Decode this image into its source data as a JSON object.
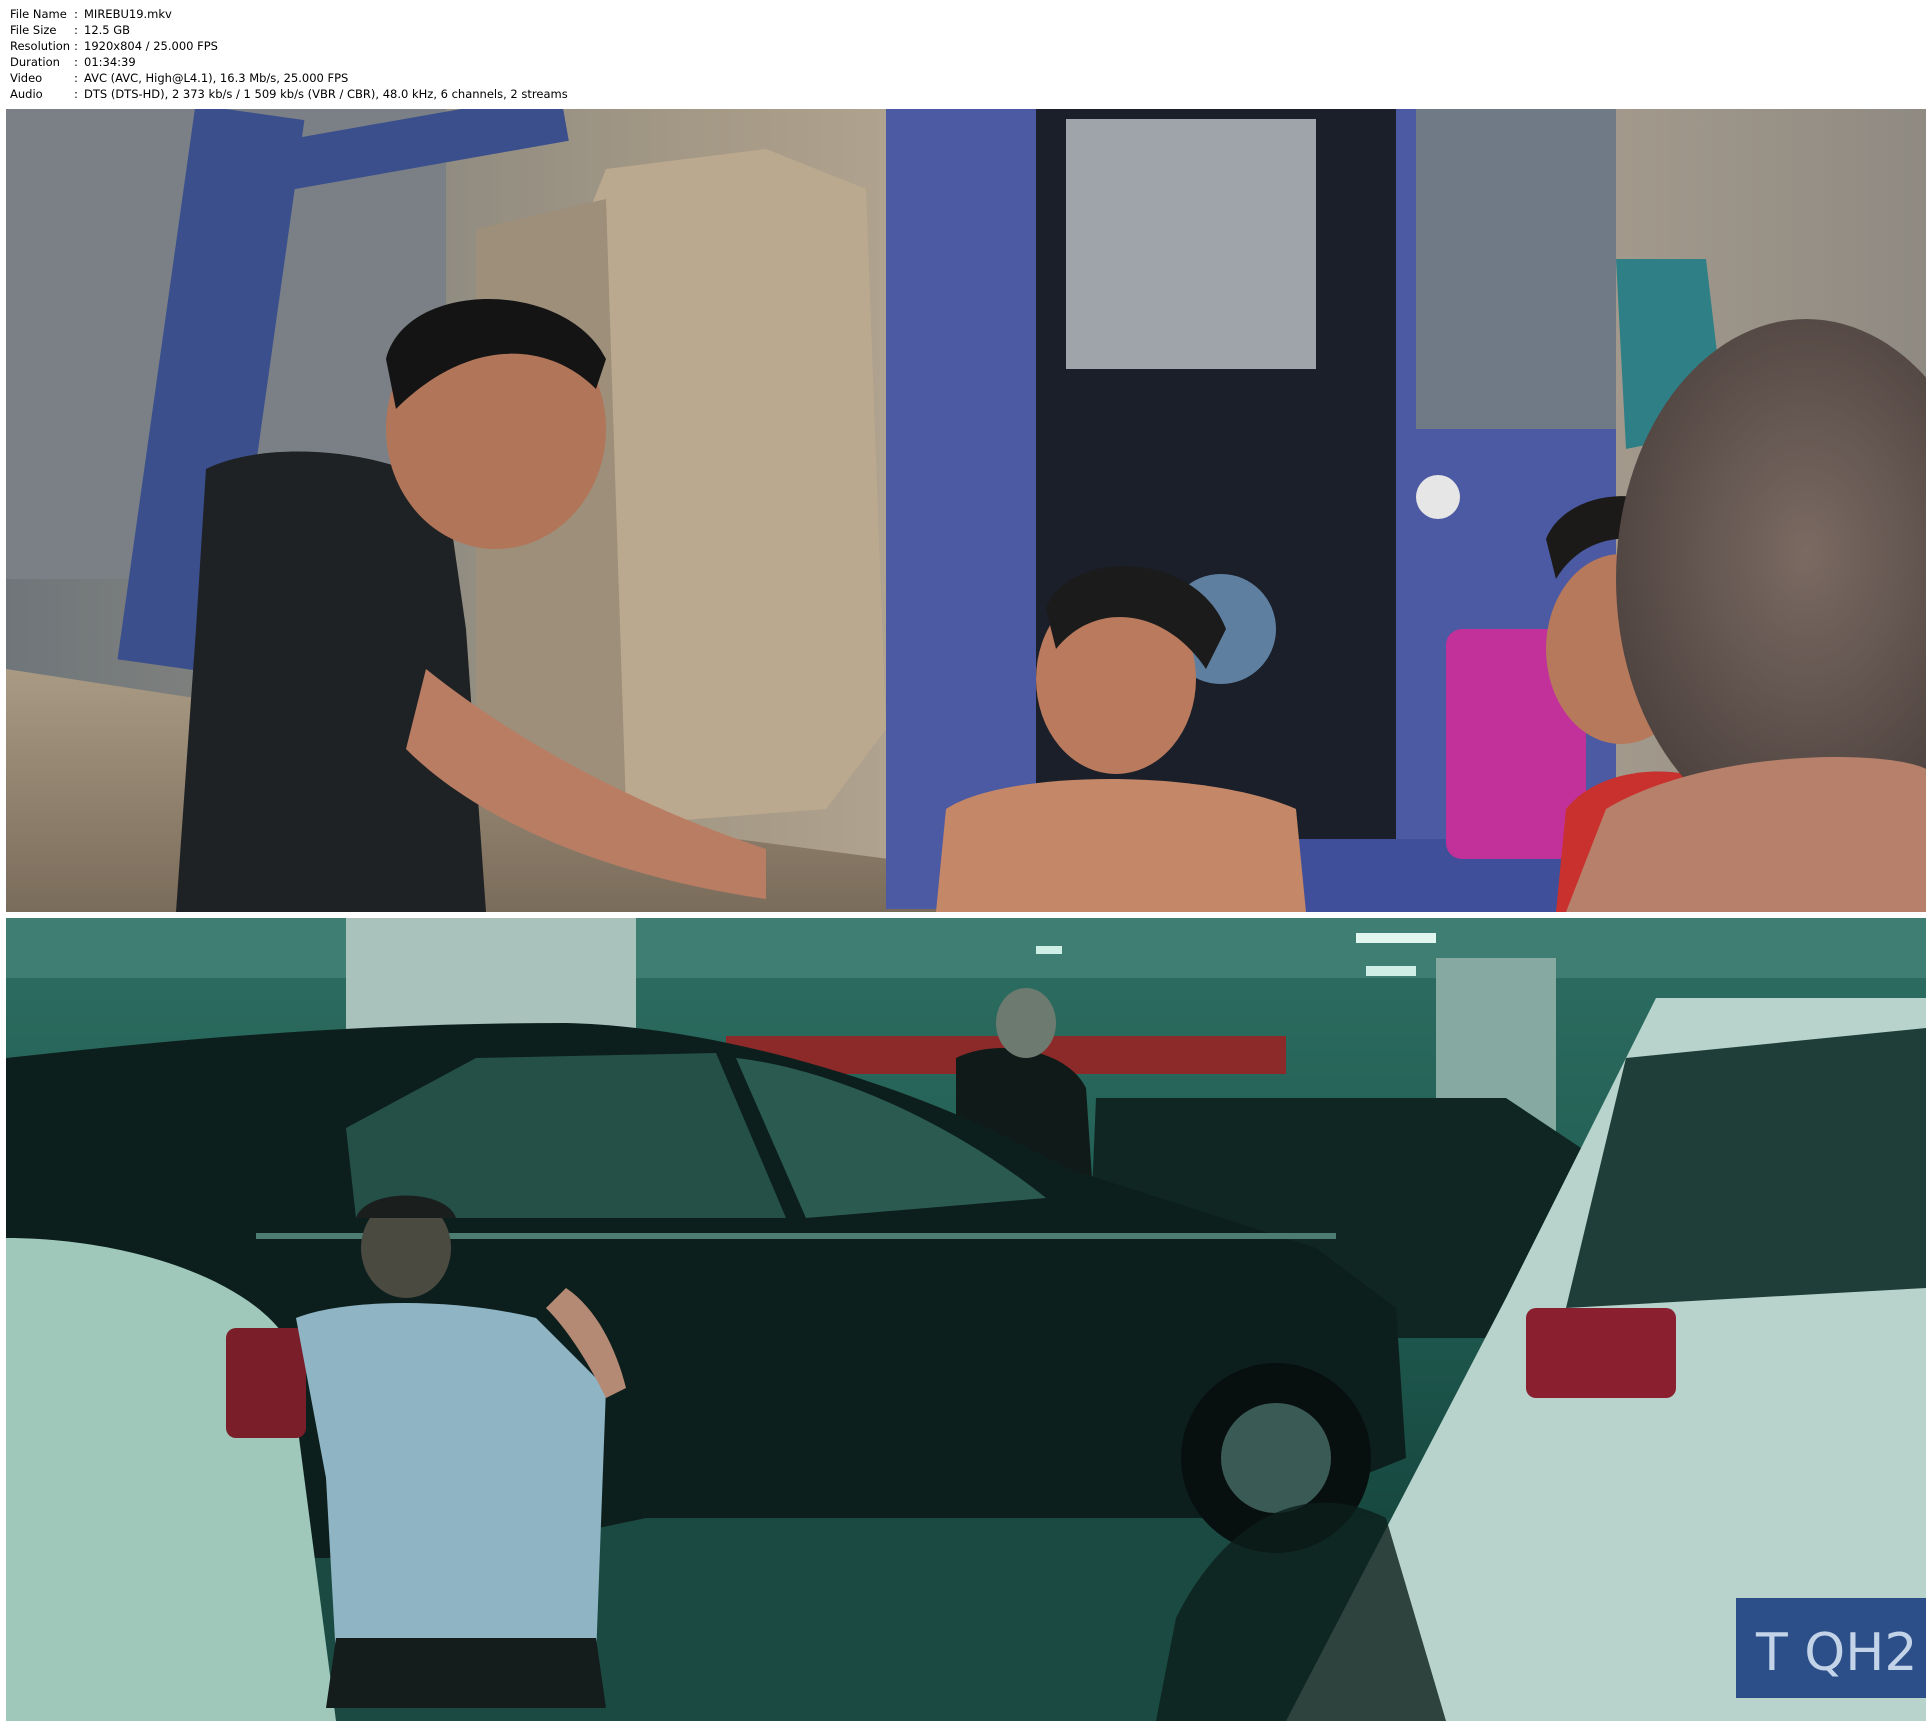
{
  "media_info": {
    "rows": [
      {
        "key": "File Name",
        "value": "MIREBU19.mkv"
      },
      {
        "key": "File Size",
        "value": "12.5 GB"
      },
      {
        "key": "Resolution",
        "value": "1920x804 / 25.000 FPS"
      },
      {
        "key": "Duration",
        "value": "01:34:39"
      },
      {
        "key": "Video",
        "value": "AVC (AVC, High@L4.1), 16.3 Mb/s, 25.000 FPS"
      },
      {
        "key": "Audio",
        "value": "DTS (DTS-HD), 2 373 kb/s / 1 509 kb/s (VBR / CBR), 48.0 kHz, 6 channels, 2 streams"
      }
    ],
    "separator": ":"
  },
  "frames": [
    {
      "name": "frame-1",
      "scene": "excavator-demolition-site",
      "palette": {
        "sky": "#c9c2b3",
        "wall": "#b8a68c",
        "excavator": "#4a5aa6",
        "shirt": "#1f2224",
        "skin": "#c99072",
        "red_shirt": "#c9312f",
        "canister": "#c2309a"
      }
    },
    {
      "name": "frame-2",
      "scene": "underground-parking-garage",
      "palette": {
        "ambient": "#1f5a50",
        "car": "#0d1f1d",
        "shirt": "#8fb4c4",
        "banner": "#8c2a2a",
        "plate": "#2c4f8a"
      },
      "plate_text": "T QH2"
    }
  ]
}
